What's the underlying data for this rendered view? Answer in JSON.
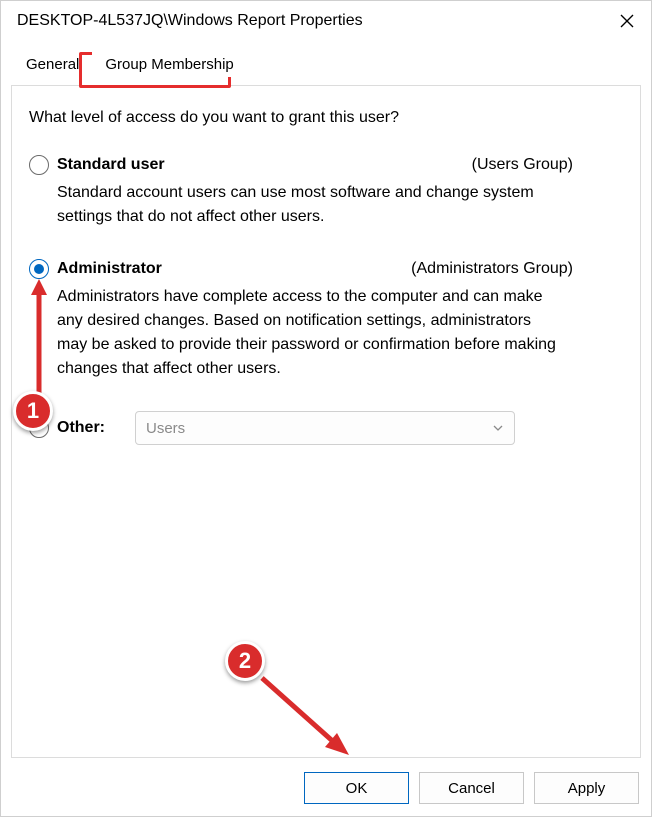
{
  "window": {
    "title": "DESKTOP-4L537JQ\\Windows Report Properties"
  },
  "tabs": {
    "general": "General",
    "group_membership": "Group Membership"
  },
  "content": {
    "question": "What level of access do you want to grant this user?",
    "standard": {
      "label": "Standard user",
      "group": "(Users Group)",
      "desc": "Standard account users can use most software and change system settings that do not affect other users."
    },
    "admin": {
      "label": "Administrator",
      "group": "(Administrators Group)",
      "desc": "Administrators have complete access to the computer and can make any desired changes. Based on notification settings, administrators may be asked to provide their password or confirmation before making changes that affect other users."
    },
    "other": {
      "label": "Other:",
      "selected": "Users"
    }
  },
  "buttons": {
    "ok": "OK",
    "cancel": "Cancel",
    "apply": "Apply"
  },
  "annotations": {
    "badge1": "1",
    "badge2": "2"
  }
}
